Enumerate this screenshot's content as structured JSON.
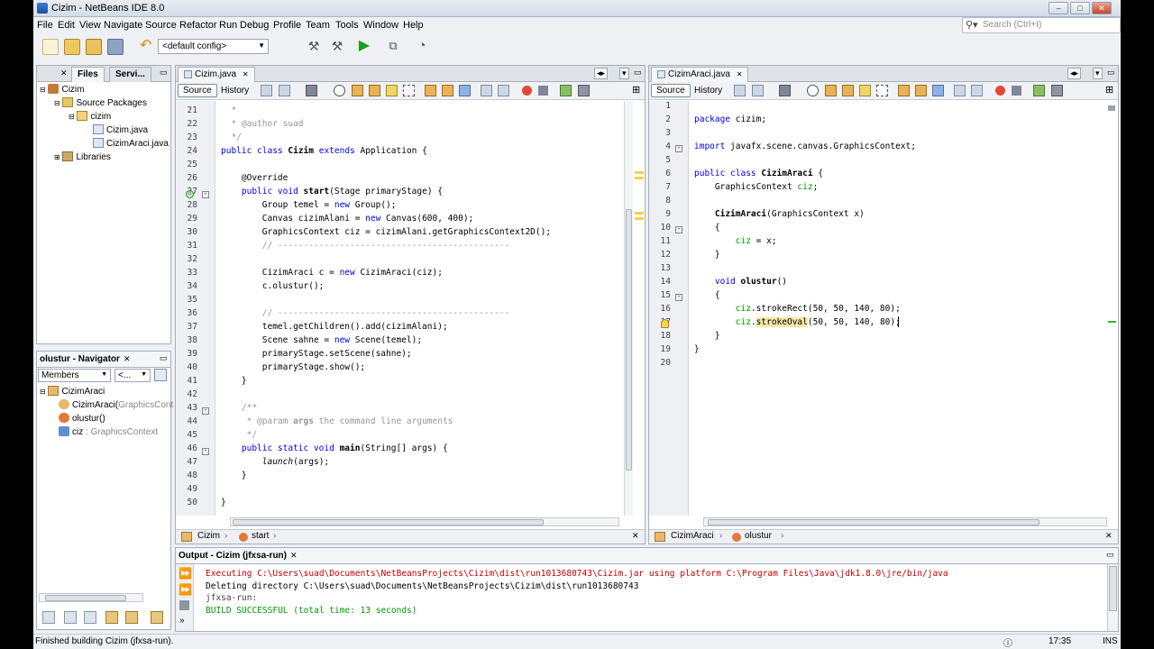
{
  "window": {
    "title": "Cizim - NetBeans IDE 8.0"
  },
  "menu": [
    "File",
    "Edit",
    "View",
    "Navigate",
    "Source",
    "Refactor",
    "Run",
    "Debug",
    "Profile",
    "Team",
    "Tools",
    "Window",
    "Help"
  ],
  "search": {
    "placeholder": "Search (Ctrl+I)"
  },
  "toolbar": {
    "config": "<default config>"
  },
  "projects": {
    "tabs": [
      "Files",
      "Servi..."
    ],
    "tree": [
      "Cizim",
      "Source Packages",
      "cizim",
      "Cizim.java",
      "CizimAraci.java",
      "Libraries"
    ]
  },
  "navigator": {
    "title": "olustur - Navigator",
    "filter": "Members",
    "filter2": "<...",
    "items": [
      "CizimAraci",
      "CizimAraci(GraphicsContext",
      "olustur()",
      "ciz : GraphicsContext"
    ],
    "item1_prefix": "CizimAraci(",
    "item1_suffix": "GraphicsCont",
    "item3_name": "ciz",
    "item3_type": " : GraphicsContext"
  },
  "editor_left": {
    "tab": "Cizim.java",
    "source_label": "Source",
    "history_label": "History",
    "lines": [
      "21",
      "22",
      "23",
      "24",
      "25",
      "26",
      "27",
      "28",
      "29",
      "30",
      "31",
      "32",
      "33",
      "34",
      "35",
      "36",
      "37",
      "38",
      "39",
      "40",
      "41",
      "42",
      "43",
      "44",
      "45",
      "46",
      "47",
      "48",
      "49",
      "50"
    ],
    "breadcrumb": [
      "Cizim",
      "start"
    ]
  },
  "editor_right": {
    "tab": "CizimAraci.java",
    "source_label": "Source",
    "history_label": "History",
    "lines": [
      "1",
      "2",
      "3",
      "4",
      "5",
      "6",
      "7",
      "8",
      "9",
      "10",
      "11",
      "12",
      "13",
      "14",
      "15",
      "16",
      "17",
      "18",
      "19",
      "20"
    ],
    "breadcrumb": [
      "CizimAraci",
      "olustur"
    ]
  },
  "output": {
    "title": "Output - Cizim (jfxsa-run)",
    "lines": [
      "Executing C:\\Users\\suad\\Documents\\NetBeansProjects\\Cizim\\dist\\run1013680743\\Cizim.jar using platform C:\\Program Files\\Java\\jdk1.8.0\\jre/bin/java",
      "Deleting directory C:\\Users\\suad\\Documents\\NetBeansProjects\\Cizim\\dist\\run1013680743",
      "jfxsa-run:",
      "BUILD SUCCESSFUL (total time: 13 seconds)"
    ]
  },
  "status": {
    "message": "Finished building Cizim (jfxsa-run).",
    "position": "17:35",
    "mode": "INS"
  },
  "colors": {
    "keyword": "#0000e6",
    "comment": "#969696",
    "field": "#009900",
    "error": "#c00000"
  }
}
